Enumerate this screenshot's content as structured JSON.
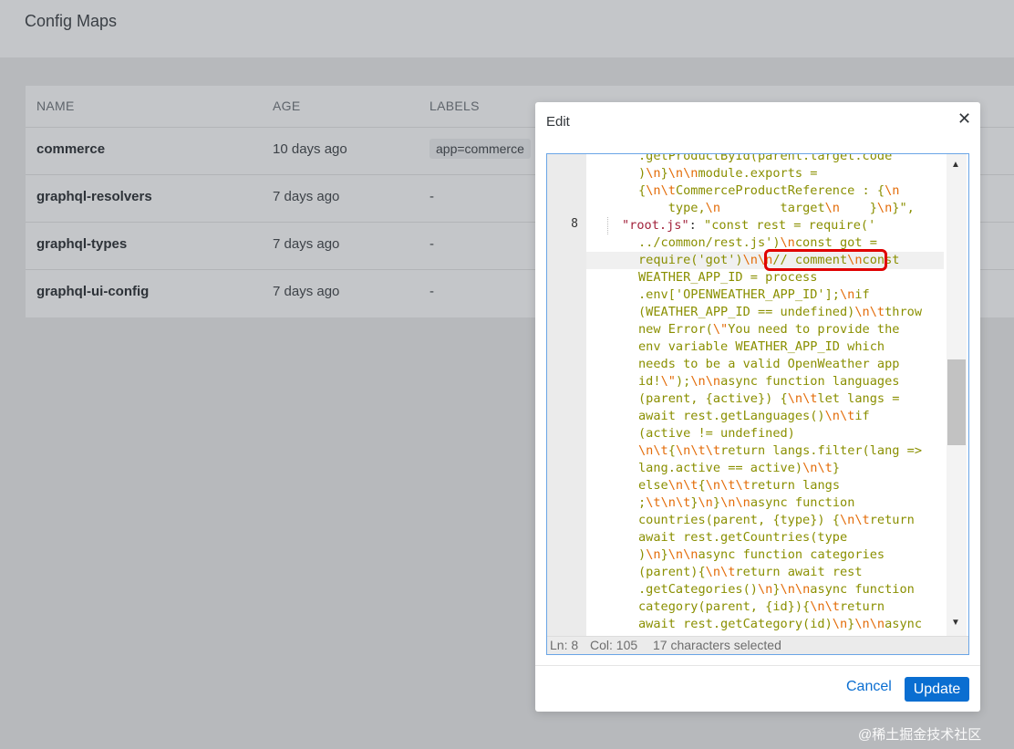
{
  "page": {
    "title": "Config Maps"
  },
  "table": {
    "columns": [
      "NAME",
      "AGE",
      "LABELS"
    ],
    "rows": [
      {
        "name": "commerce",
        "age": "10 days ago",
        "labels": "app=commerce"
      },
      {
        "name": "graphql-resolvers",
        "age": "7 days ago",
        "labels": "-"
      },
      {
        "name": "graphql-types",
        "age": "7 days ago",
        "labels": "-"
      },
      {
        "name": "graphql-ui-config",
        "age": "7 days ago",
        "labels": "-"
      }
    ]
  },
  "modal": {
    "title": "Edit",
    "close_label": "✕",
    "cancel_label": "Cancel",
    "update_label": "Update",
    "editor": {
      "line_number": "8",
      "code_lines": [
        {
          "text": ".getProductById(parent.target.code"
        },
        {
          "text": ")\\n}\\n\\nmodule.exports ="
        },
        {
          "text": "{\\n\\tCommerceProductReference : {\\n"
        },
        {
          "text": "    type,\\n        target\\n    }\\n}\","
        },
        {
          "key": "\"root.js\"",
          "sep": ": ",
          "text": "\"const rest = require('"
        },
        {
          "text": "../common/rest.js')\\nconst got ="
        },
        {
          "text": "require('got')\\n\\n// comment\\nconst"
        },
        {
          "text": "WEATHER_APP_ID = process"
        },
        {
          "text": ".env['OPENWEATHER_APP_ID'];\\nif"
        },
        {
          "text": "(WEATHER_APP_ID == undefined)\\n\\tthrow"
        },
        {
          "text": "new Error(\\\"You need to provide the"
        },
        {
          "text": "env variable WEATHER_APP_ID which"
        },
        {
          "text": "needs to be a valid OpenWeather app"
        },
        {
          "text": "id!\\\");\\n\\nasync function languages"
        },
        {
          "text": "(parent, {active}) {\\n\\tlet langs ="
        },
        {
          "text": "await rest.getLanguages()\\n\\tif"
        },
        {
          "text": "(active != undefined)"
        },
        {
          "text": "\\n\\t{\\n\\t\\treturn langs.filter(lang =>"
        },
        {
          "text": "lang.active == active)\\n\\t}"
        },
        {
          "text": "else\\n\\t{\\n\\t\\treturn langs"
        },
        {
          "text": ";\\t\\n\\t}\\n}\\n\\nasync function"
        },
        {
          "text": "countries(parent, {type}) {\\n\\treturn"
        },
        {
          "text": "await rest.getCountries(type"
        },
        {
          "text": ")\\n}\\n\\nasync function categories"
        },
        {
          "text": "(parent){\\n\\treturn await rest"
        },
        {
          "text": ".getCategories()\\n}\\n\\nasync function"
        },
        {
          "text": "category(parent, {id}){\\n\\treturn"
        },
        {
          "text": "await rest.getCategory(id)\\n}\\n\\nasync"
        }
      ]
    },
    "status": {
      "line": "Ln: 8",
      "col": "Col: 105",
      "selection": "17 characters selected"
    }
  },
  "watermark": "@稀土掘金技术社区",
  "colors": {
    "accent": "#0a6ed1",
    "highlight": "#e00000",
    "string": "#8a8f00",
    "key": "#a2223b",
    "escape": "#e36c09"
  }
}
